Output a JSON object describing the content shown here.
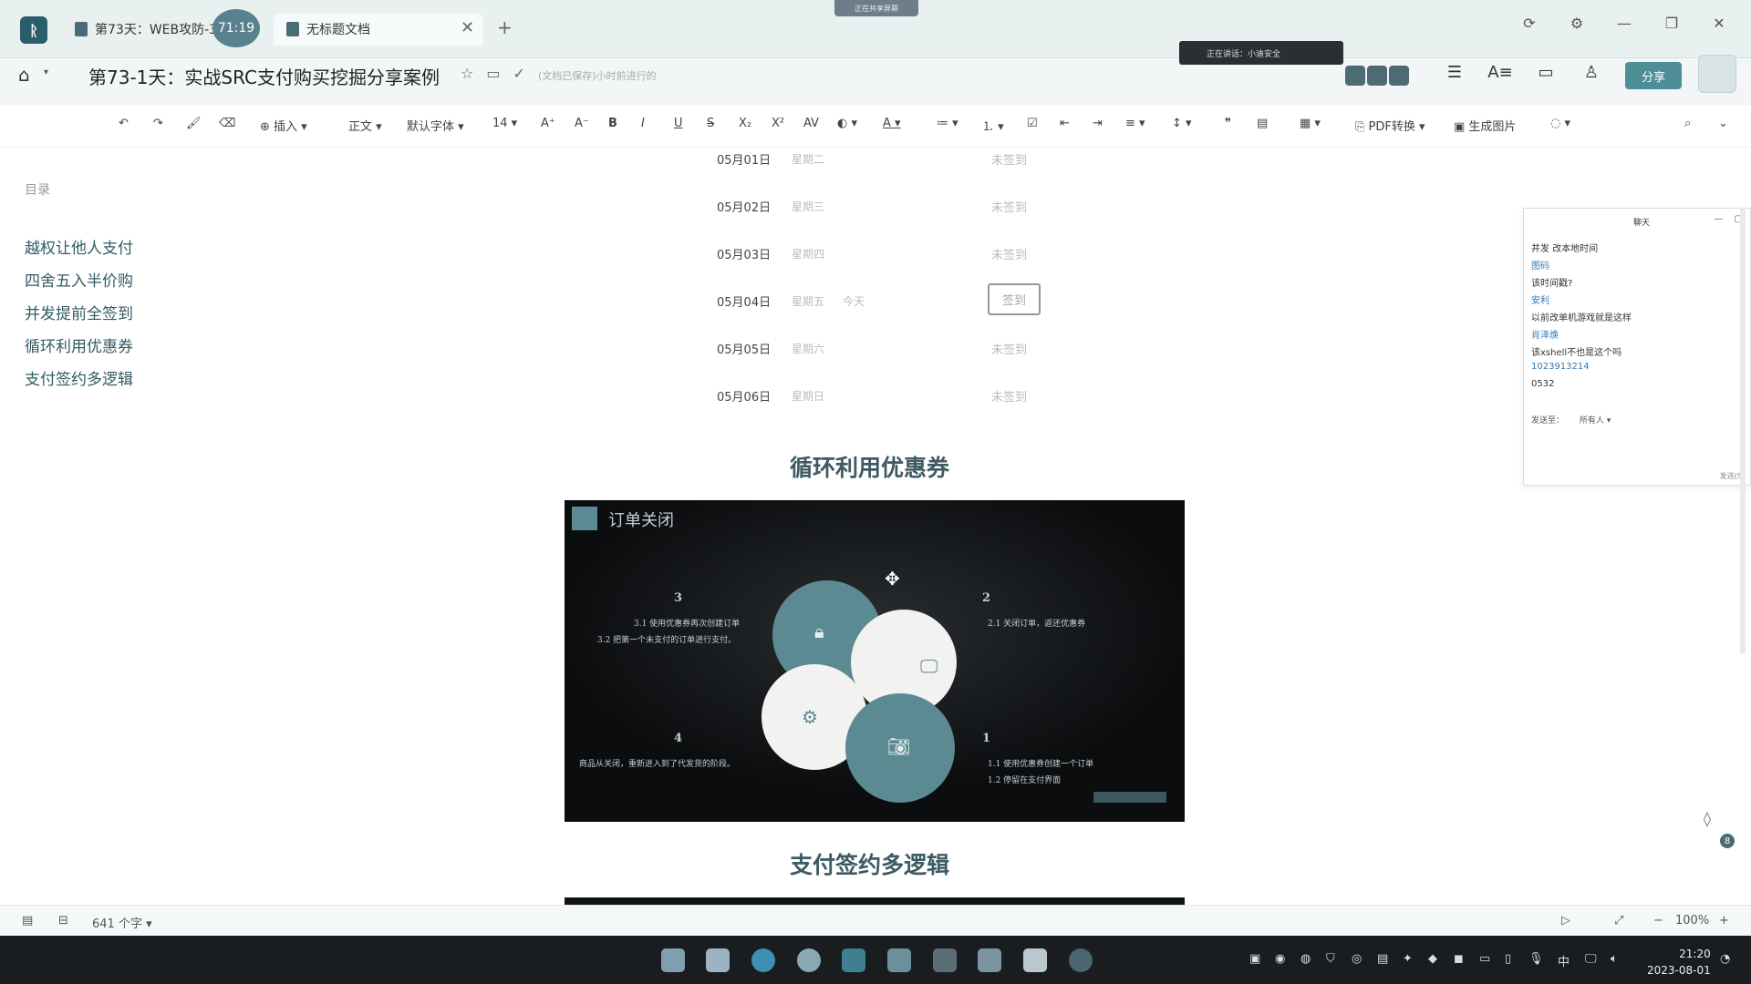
{
  "tabs": [
    {
      "label": "第73天：WEB攻防-3"
    },
    {
      "label": "无标题文档"
    }
  ],
  "timer": "71:19",
  "notice_pill": "正在共享屏幕",
  "document": {
    "title": "第73-1天：实战SRC支付购买挖掘分享案例",
    "save_status": "(文档已保存)小时前进行的"
  },
  "screen_share": "正在讲话：小迪安全",
  "share_label": "分享",
  "toolbar": {
    "insert": "插入",
    "style": "正文",
    "font": "默认字体",
    "size": "14",
    "bold": "B",
    "italic": "I",
    "underline": "U",
    "strike": "S",
    "pdf": "PDF转换",
    "gen_image": "生成图片"
  },
  "outline": {
    "title": "目录",
    "items": [
      "越权让他人支付",
      "四舍五入半价购",
      "并发提前全签到",
      "循环利用优惠券",
      "支付签约多逻辑"
    ]
  },
  "signin_rows": [
    {
      "date": "05月01日",
      "week": "星期二",
      "status": "未签到"
    },
    {
      "date": "05月02日",
      "week": "星期三",
      "status": "未签到"
    },
    {
      "date": "05月03日",
      "week": "星期四",
      "status": "未签到"
    },
    {
      "date": "05月04日",
      "week": "星期五",
      "today": "今天",
      "status": "签到"
    },
    {
      "date": "05月05日",
      "week": "星期六",
      "status": "未签到"
    },
    {
      "date": "05月06日",
      "week": "星期日",
      "status": "未签到"
    }
  ],
  "sections": {
    "coupon": "循环利用优惠券",
    "contract": "支付签约多逻辑"
  },
  "slide": {
    "title": "订单关闭",
    "steps": [
      {
        "num": "3",
        "lines": [
          "3.1  使用优惠券再次创建订单",
          "3.2  把第一个未支付的订单进行支付。"
        ]
      },
      {
        "num": "2",
        "lines": [
          "2.1  关闭订单，返还优惠券"
        ]
      },
      {
        "num": "4",
        "lines": [
          "商品从关闭，重新进入到了代发货的阶段。"
        ]
      },
      {
        "num": "1",
        "lines": [
          "1.1  使用优惠券创建一个订单",
          "1.2  停留在支付界面"
        ]
      }
    ]
  },
  "chat": {
    "title": "聊天",
    "messages": [
      {
        "text": "并发 改本地时间",
        "kind": "msg"
      },
      {
        "text": "图码",
        "kind": "name"
      },
      {
        "text": "该时间戳?",
        "kind": "msg"
      },
      {
        "text": "安利",
        "kind": "name"
      },
      {
        "text": "以前改单机游戏就是这样",
        "kind": "msg"
      },
      {
        "text": "肖泽焕",
        "kind": "name"
      },
      {
        "text": "该xshell不也是这个吗",
        "kind": "msg"
      },
      {
        "text": "1023913214",
        "kind": "name"
      },
      {
        "text": "0532",
        "kind": "msg"
      }
    ],
    "send_to_label": "发送至：",
    "send_to_value": "所有人",
    "send_button": "发送(S)"
  },
  "statusbar": {
    "word_count": "641 个字",
    "zoom": "100%"
  },
  "clock": {
    "time": "21:20",
    "date": "2023-08-01"
  },
  "float_badge": "8",
  "colors": {
    "accent": "#4e8f97",
    "slide_petal": "#5c8a93",
    "heading": "#3e5a63"
  }
}
